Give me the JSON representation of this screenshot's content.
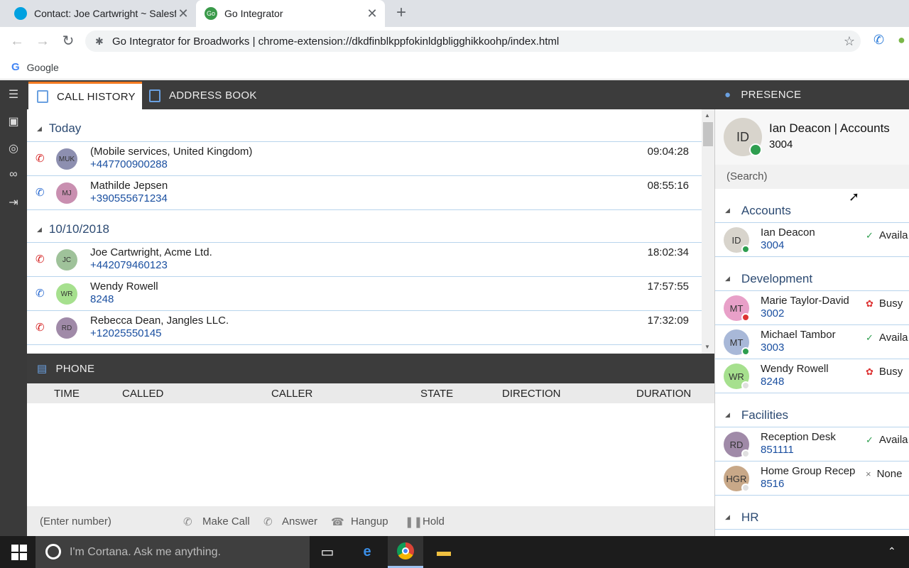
{
  "browser": {
    "tabs": [
      {
        "title": "Contact: Joe Cartwright ~ Salesfo",
        "active": false
      },
      {
        "title": "Go Integrator",
        "active": true
      }
    ],
    "url": "Go Integrator for Broadworks | chrome-extension://dkdfinblkppfokinldgbligghikkoohp/index.html",
    "bookmark": "Google"
  },
  "app": {
    "tabs": {
      "call_history": "CALL HISTORY",
      "address_book": "ADDRESS BOOK"
    },
    "call_groups": [
      {
        "label": "Today",
        "calls": [
          {
            "initials": "MUK",
            "name": "(Mobile services, United Kingdom)",
            "number": "+447700900288",
            "time": "09:04:28",
            "type": "missed",
            "avatar_color": "#8d8fb0"
          },
          {
            "initials": "MJ",
            "name": "Mathilde Jepsen",
            "number": "+390555671234",
            "time": "08:55:16",
            "type": "outgoing",
            "avatar_color": "#c98fb0"
          }
        ]
      },
      {
        "label": "10/10/2018",
        "calls": [
          {
            "initials": "JC",
            "name": "Joe Cartwright, Acme Ltd.",
            "number": "+442079460123",
            "time": "18:02:34",
            "type": "missed",
            "avatar_color": "#9fc29a"
          },
          {
            "initials": "WR",
            "name": "Wendy Rowell",
            "number": "8248",
            "time": "17:57:55",
            "type": "outgoing",
            "avatar_color": "#a6e08e"
          },
          {
            "initials": "RD",
            "name": "Rebecca Dean, Jangles LLC.",
            "number": "+12025550145",
            "time": "17:32:09",
            "type": "missed",
            "avatar_color": "#a08aa8"
          }
        ]
      }
    ],
    "phone": {
      "title": "PHONE",
      "columns": [
        "TIME",
        "CALLED",
        "CALLER",
        "STATE",
        "DIRECTION",
        "DURATION"
      ],
      "input_placeholder": "(Enter number)",
      "actions": {
        "make_call": "Make Call",
        "answer": "Answer",
        "hangup": "Hangup",
        "hold": "Hold"
      }
    },
    "presence": {
      "title": "PRESENCE",
      "me": {
        "initials": "ID",
        "name": "Ian Deacon | Accounts",
        "ext": "3004"
      },
      "search_placeholder": "(Search)",
      "groups": [
        {
          "label": "Accounts",
          "members": [
            {
              "initials": "ID",
              "name": "Ian Deacon",
              "ext": "3004",
              "status": "Availa",
              "dot": "#2e9e4f",
              "avatar_color": "#d8d4cc"
            }
          ]
        },
        {
          "label": "Development",
          "members": [
            {
              "initials": "MT",
              "name": "Marie Taylor-David",
              "ext": "3002",
              "status": "Busy",
              "dot": "#d33",
              "avatar_color": "#e8a0c8"
            },
            {
              "initials": "MT",
              "name": "Michael Tambor",
              "ext": "3003",
              "status": "Availa",
              "dot": "#2e9e4f",
              "avatar_color": "#a8b8d8"
            },
            {
              "initials": "WR",
              "name": "Wendy Rowell",
              "ext": "8248",
              "status": "Busy",
              "dot": "#e0e0e0",
              "avatar_color": "#a6e08e"
            }
          ]
        },
        {
          "label": "Facilities",
          "members": [
            {
              "initials": "RD",
              "name": "Reception Desk",
              "ext": "851111",
              "status": "Availa",
              "dot": "#e0e0e0",
              "avatar_color": "#a08aa8"
            },
            {
              "initials": "HGR",
              "name": "Home Group Recep",
              "ext": "8516",
              "status": "None",
              "dot": "#e0e0e0",
              "avatar_color": "#c8a888"
            }
          ]
        },
        {
          "label": "HR",
          "members": []
        }
      ]
    }
  },
  "taskbar": {
    "cortana_placeholder": "I'm Cortana. Ask me anything."
  }
}
